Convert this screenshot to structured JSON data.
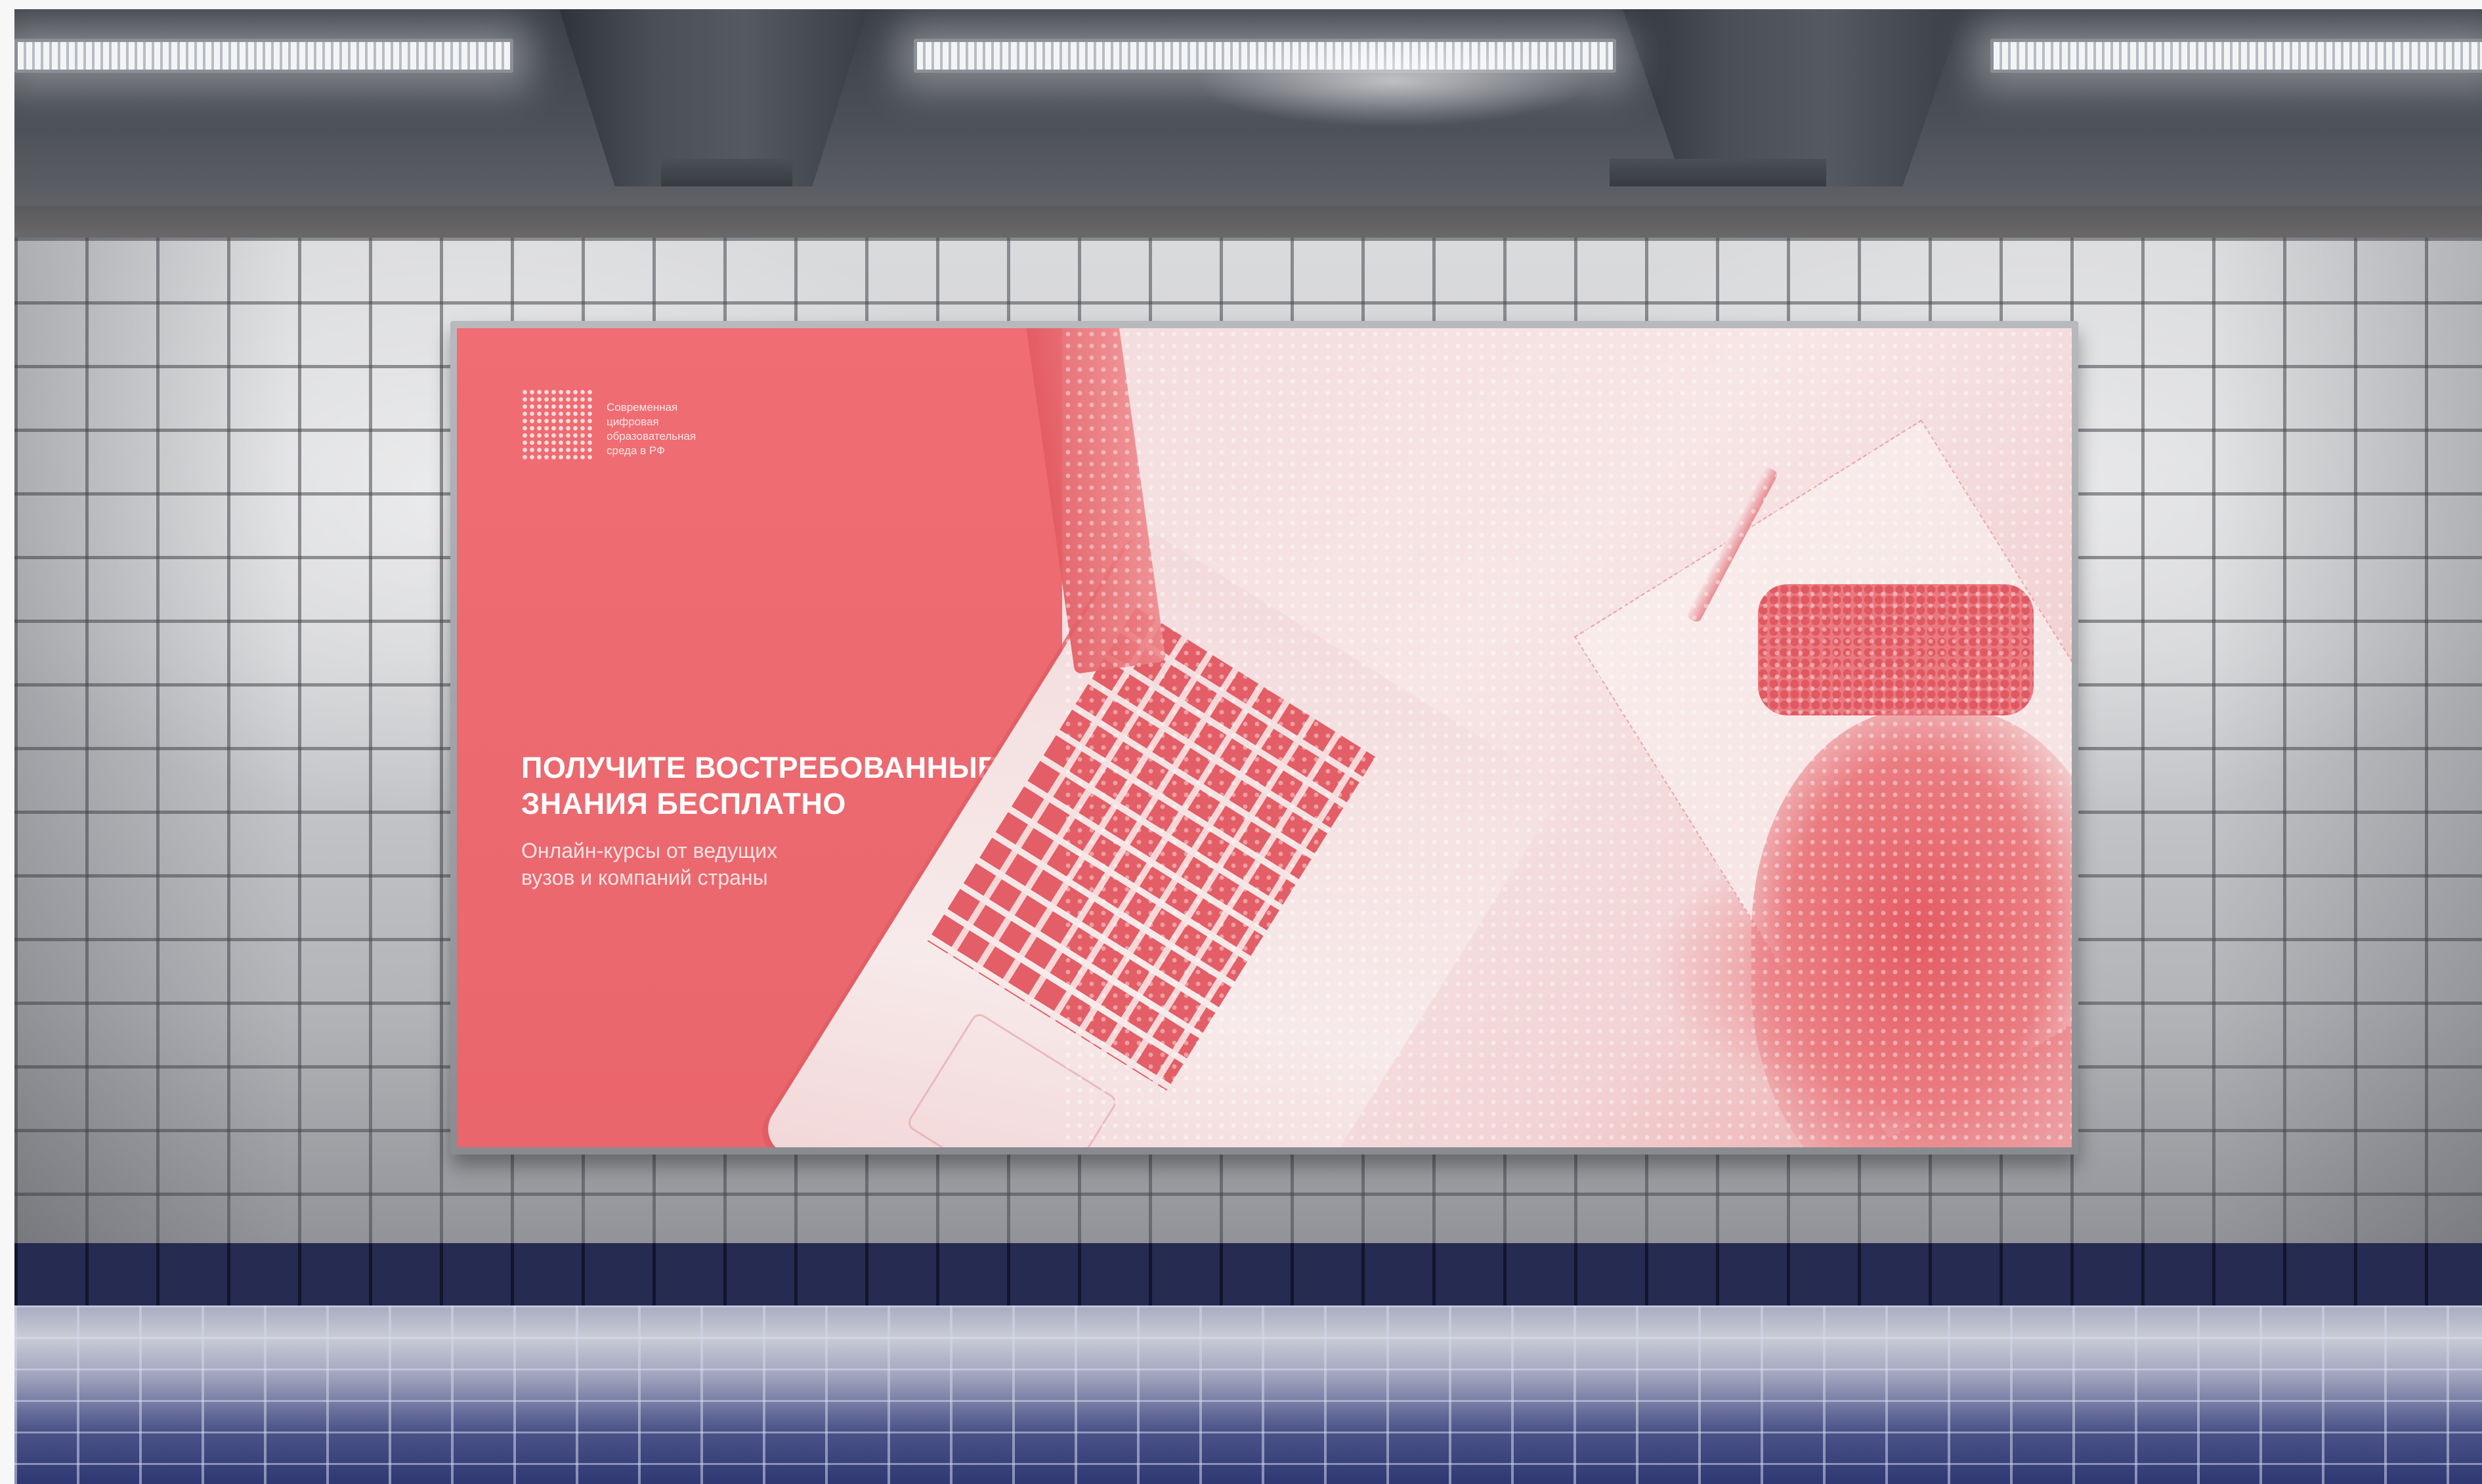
{
  "billboard": {
    "logo": {
      "lines": [
        "Современная",
        "цифровая",
        "образовательная",
        "среда в РФ"
      ]
    },
    "headline": {
      "lines": [
        "ПОЛУЧИТЕ ВОСТРЕБОВАННЫЕ",
        "ЗНАНИЯ БЕСПЛАТНО"
      ]
    },
    "subline": {
      "lines": [
        "Онлайн-курсы от ведущих",
        "вузов и компаний страны"
      ]
    }
  },
  "colors": {
    "poster_red": "#ee6b70",
    "band_blue": "#262b52",
    "wall_tile": "#c9cacd"
  }
}
